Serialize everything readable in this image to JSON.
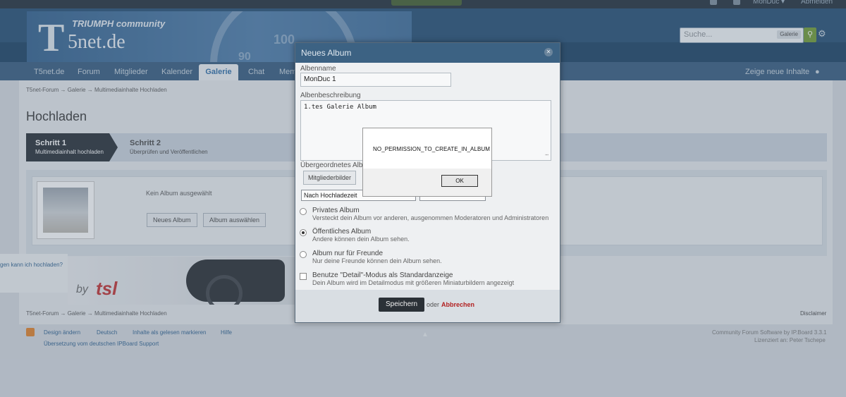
{
  "topbar": {
    "username": "MonDuc ▾",
    "logout": "Abmelden"
  },
  "header": {
    "logo_community": "TRIUMPH community",
    "logo_t": "T",
    "logo_name": "5net.de",
    "gauge_a": "100",
    "gauge_b": "90",
    "search_placeholder": "Suche...",
    "search_scope": "Galerie"
  },
  "nav": {
    "items": [
      "T5net.de",
      "Forum",
      "Mitglieder",
      "Kalender",
      "Galerie",
      "Chat",
      "Mem"
    ],
    "active": "Galerie",
    "new_content": "Zeige neue Inhalte"
  },
  "breadcrumb": {
    "a": "T5net-Forum",
    "sep": "→",
    "b": "Galerie",
    "c": "Multimediainhalte Hochladen"
  },
  "page": {
    "title": "Hochladen"
  },
  "steps": [
    {
      "title": "Schritt 1",
      "desc": "Multimediainhalt hochladen"
    },
    {
      "title": "Schritt 2",
      "desc": "Überprüfen und Veröffentlichen"
    }
  ],
  "upload": {
    "no_album": "Kein Album ausgewählt",
    "new_album": "Neues Album",
    "choose_album": "Album auswählen",
    "help": "gen kann ich hochladen?"
  },
  "banner": {
    "by": "by",
    "brand": "tsl"
  },
  "footer": {
    "links": [
      "Design ändern",
      "Deutsch",
      "Inhalte als gelesen markieren",
      "Hilfe"
    ],
    "translation": "Übersetzung vom deutschen IPBoard Support",
    "disclaimer": "Disclaimer",
    "software": "Community Forum Software by IP.Board 3.3.1",
    "license": "Lizenziert an: Peter Tschepe"
  },
  "modal": {
    "title": "Neues Album",
    "name_label": "Albenname",
    "name_value": "MonDuc 1",
    "desc_label": "Albenbeschreibung",
    "desc_value": "1.tes Galerie Album",
    "parent_label": "Übergeordnetes Albu",
    "parent_button": "Mitgliederbilder",
    "sort_value": "Nach Hochladezeit",
    "options": [
      {
        "title": "Privates Album",
        "desc": "Versteckt dein Album vor anderen, ausgenommen Moderatoren und Administratoren",
        "checked": false
      },
      {
        "title": "Öffentliches Album",
        "desc": "Andere können dein Album sehen.",
        "checked": true
      },
      {
        "title": "Album nur für Freunde",
        "desc": "Nur deine Freunde können dein Album sehen.",
        "checked": false
      }
    ],
    "detail_title": "Benutze \"Detail\"-Modus als Standardanzeige",
    "detail_desc": "Dein Album wird im Detailmodus mit größeren Miniaturbildern angezeigt",
    "save": "Speichern",
    "or": "oder",
    "cancel": "Abbrechen"
  },
  "alert": {
    "message": "NO_PERMISSION_TO_CREATE_IN_ALBUM",
    "ok": "OK"
  }
}
